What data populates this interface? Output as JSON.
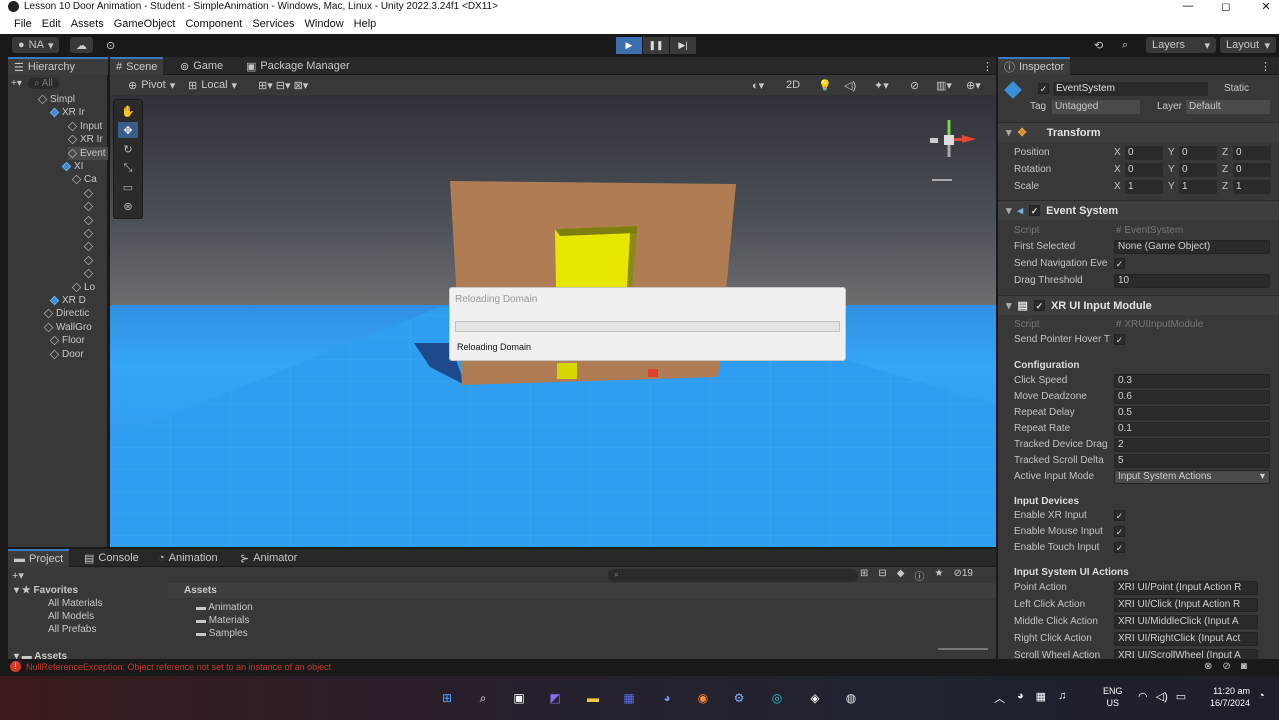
{
  "window": {
    "title": "Lesson 10 Door Animation - Student - SimpleAnimation - Windows, Mac, Linux - Unity 2022.3.24f1 <DX11>",
    "min": "—",
    "max": "◻",
    "close": "✕"
  },
  "menu": [
    "File",
    "Edit",
    "Assets",
    "GameObject",
    "Component",
    "Services",
    "Window",
    "Help"
  ],
  "toolbar": {
    "account": "NA",
    "layers": "Layers",
    "layout": "Layout"
  },
  "hierarchy": {
    "tab": "Hierarchy",
    "search": "All",
    "items": [
      "SimpleAnimation",
      "XR Interaction Manager",
      "Input",
      "XR Interaction Setup",
      "EventSystem",
      "XR Origin",
      "Camera Offset",
      "",
      "",
      "",
      "",
      "",
      "",
      "",
      "Locomotion",
      "XR Device Simulator",
      "Directional Light",
      "WallGroup",
      "Floor",
      "Door"
    ],
    "labels_visible": [
      "Simpl",
      "XR Ir",
      "Input",
      "XR Ir",
      "Event",
      "XI",
      "Ca",
      "",
      "",
      "",
      "",
      "",
      "",
      "",
      "Lo",
      "XR D",
      "Directic",
      "WallGro",
      "Floor",
      "Door"
    ]
  },
  "scene": {
    "tabs": [
      "Scene",
      "Game",
      "Package Manager"
    ],
    "pivot": "Pivot",
    "local": "Local",
    "mode2d": "2D"
  },
  "dialog": {
    "title": "Reloading Domain",
    "message": "Reloading Domain",
    "progress": 0.0
  },
  "inspector": {
    "tab": "Inspector",
    "object_name": "EventSystem",
    "static": "Static",
    "tag_label": "Tag",
    "tag": "Untagged",
    "layer_label": "Layer",
    "layer": "Default",
    "transform": {
      "title": "Transform",
      "position_label": "Position",
      "rotation_label": "Rotation",
      "scale_label": "Scale",
      "position": [
        "0",
        "0",
        "0"
      ],
      "rotation": [
        "0",
        "0",
        "0"
      ],
      "scale": [
        "1",
        "1",
        "1"
      ]
    },
    "event_system": {
      "title": "Event System",
      "script_label": "Script",
      "script": "EventSystem",
      "first_selected_label": "First Selected",
      "first_selected": "None (Game Object)",
      "send_nav_label": "Send Navigation Eve",
      "drag_label": "Drag Threshold",
      "drag": "10"
    },
    "xr_module": {
      "title": "XR UI Input Module",
      "script_label": "Script",
      "script": "XRUIInputModule",
      "send_hover_label": "Send Pointer Hover T",
      "config_title": "Configuration",
      "fields": [
        [
          "Click Speed",
          "0.3"
        ],
        [
          "Move Deadzone",
          "0.6"
        ],
        [
          "Repeat Delay",
          "0.5"
        ],
        [
          "Repeat Rate",
          "0.1"
        ],
        [
          "Tracked Device Drag",
          "2"
        ],
        [
          "Tracked Scroll Delta",
          "5"
        ]
      ],
      "active_mode_label": "Active Input Mode",
      "active_mode": "Input System Actions",
      "devices_title": "Input Devices",
      "devices": [
        "Enable XR Input",
        "Enable Mouse Input",
        "Enable Touch Input"
      ],
      "actions_title": "Input System UI Actions",
      "actions": [
        [
          "Point Action",
          "XRI UI/Point (Input Action R"
        ],
        [
          "Left Click Action",
          "XRI UI/Click (Input Action R"
        ],
        [
          "Middle Click Action",
          "XRI UI/MiddleClick (Input A"
        ],
        [
          "Right Click Action",
          "XRI UI/RightClick (Input Act"
        ],
        [
          "Scroll Wheel Action",
          "XRI UI/ScrollWheel (Input A"
        ]
      ]
    }
  },
  "project": {
    "tabs": [
      "Project",
      "Console",
      "Animation",
      "Animator"
    ],
    "favorites": "Favorites",
    "fav_items": [
      "All Materials",
      "All Models",
      "All Prefabs"
    ],
    "assets_label": "Assets",
    "assets_tree": "Assets",
    "folders": [
      "Animation",
      "Materials",
      "Samples"
    ],
    "count": "19"
  },
  "status": {
    "error": "NullReferenceException: Object reference not set to an instance of an object"
  },
  "taskbar": {
    "lang": "ENG",
    "lang2": "US",
    "time": "11:20 am",
    "date": "16/7/2024"
  }
}
